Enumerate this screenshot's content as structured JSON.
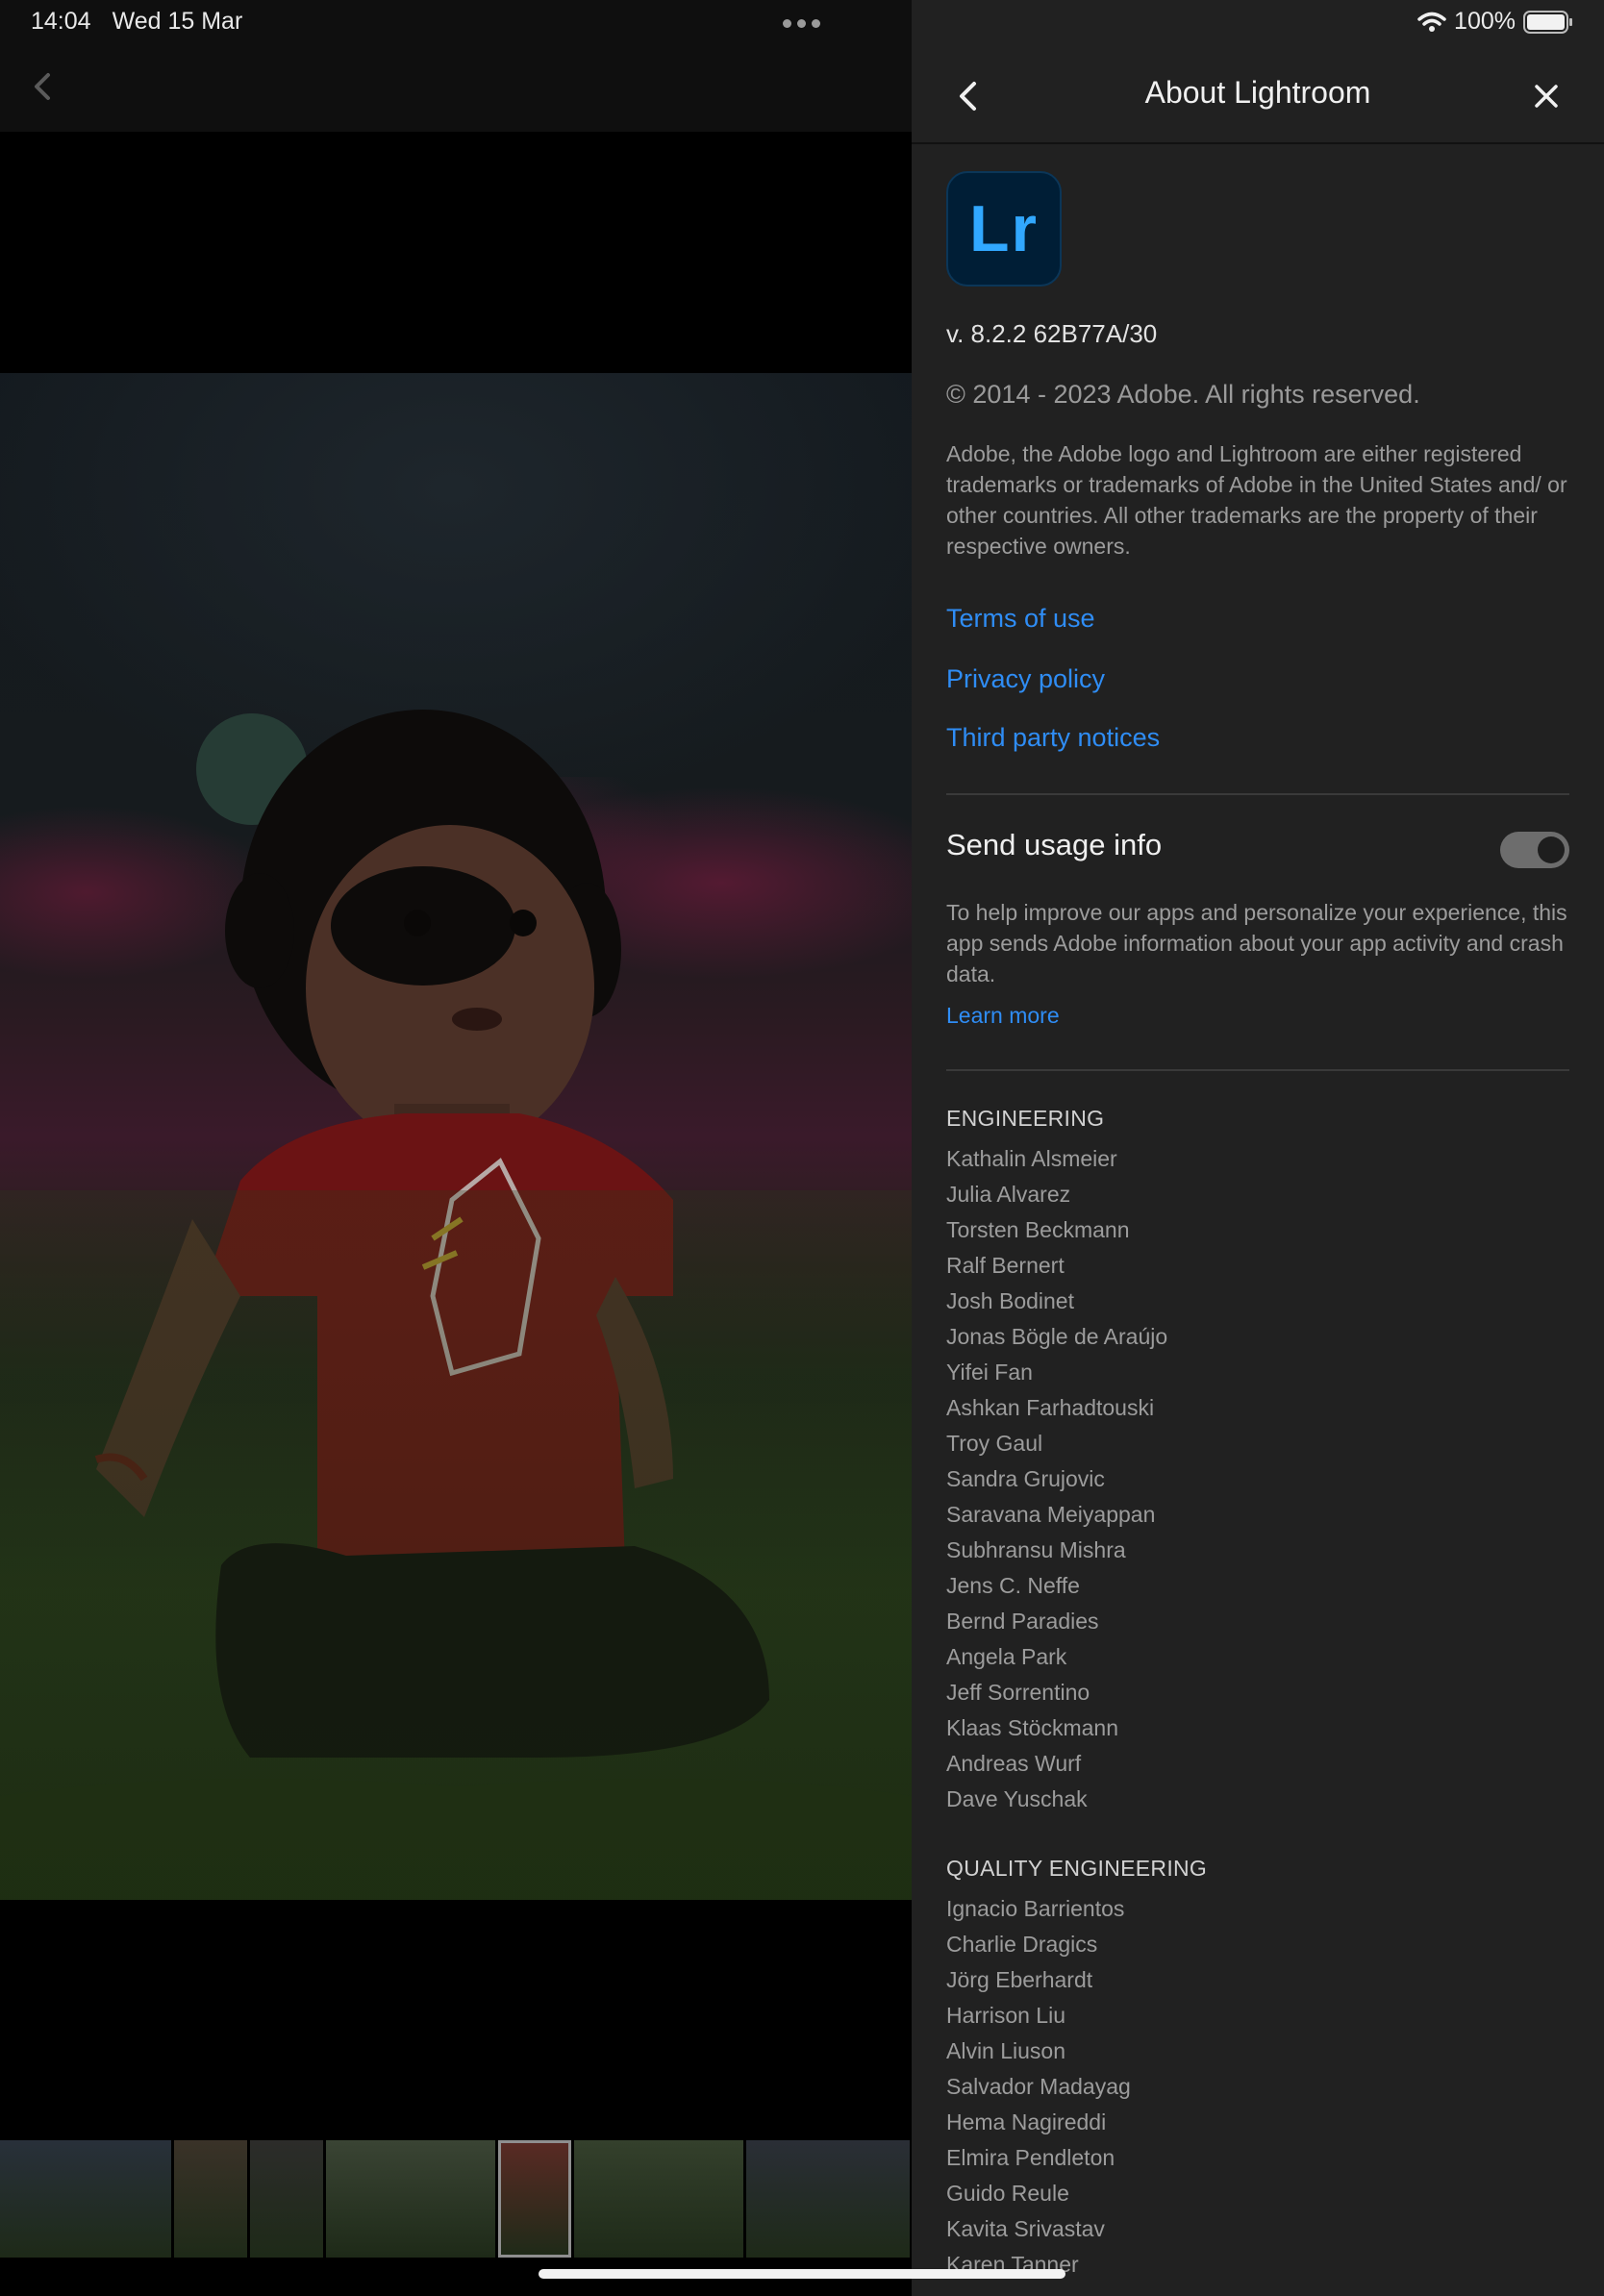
{
  "status_bar": {
    "time": "14:04",
    "date": "Wed 15 Mar",
    "battery": "100%"
  },
  "viewer": {
    "more_icon": "more-dots-icon",
    "back_icon": "chevron-left-icon",
    "photo_icon": "photo-child-sitting-on-grass"
  },
  "filmstrip": {
    "thumbnails": [
      {
        "tone": "#28303a"
      },
      {
        "tone": "#3a3228"
      },
      {
        "tone": "#2c2c2a"
      },
      {
        "tone": "#3a4434"
      },
      {
        "tone": "#5a2a24"
      },
      {
        "tone": "#34402c"
      },
      {
        "tone": "#2a2e36"
      }
    ],
    "selected_index": 4
  },
  "panel": {
    "title": "About Lightroom",
    "back_icon": "chevron-left-icon",
    "close_icon": "close-icon",
    "logo_text": "Lr",
    "version": "v. 8.2.2 62B77A/30",
    "copyright": "© 2014 - 2023 Adobe. All rights reserved.",
    "trademark": "Adobe, the Adobe logo and Lightroom are either registered trademarks or trademarks of Adobe in the United States and/ or other countries. All other trademarks are the property of their respective owners.",
    "links": {
      "terms": "Terms of use",
      "privacy": "Privacy policy",
      "third_party": "Third party notices"
    },
    "usage": {
      "label": "Send usage info",
      "enabled": true,
      "description": "To help improve our apps and personalize your experience, this app sends Adobe information about your app activity and crash data.",
      "learn_more": "Learn more"
    },
    "engineering": {
      "heading": "ENGINEERING",
      "names": [
        "Kathalin Alsmeier",
        "Julia Alvarez",
        "Torsten Beckmann",
        "Ralf Bernert",
        "Josh Bodinet",
        "Jonas Bögle de Araújo",
        "Yifei Fan",
        "Ashkan Farhadtouski",
        "Troy Gaul",
        "Sandra Grujovic",
        "Saravana Meiyappan",
        "Subhransu Mishra",
        "Jens C. Neffe",
        "Bernd Paradies",
        "Angela Park",
        "Jeff Sorrentino",
        "Klaas Stöckmann",
        "Andreas Wurf",
        "Dave Yuschak"
      ]
    },
    "quality_engineering": {
      "heading": "QUALITY ENGINEERING",
      "names": [
        "Ignacio Barrientos",
        "Charlie Dragics",
        "Jörg Eberhardt",
        "Harrison Liu",
        "Alvin Liuson",
        "Salvador Madayag",
        "Hema Nagireddi",
        "Elmira Pendleton",
        "Guido Reule",
        "Kavita Srivastav",
        "Karen Tanner"
      ]
    }
  }
}
